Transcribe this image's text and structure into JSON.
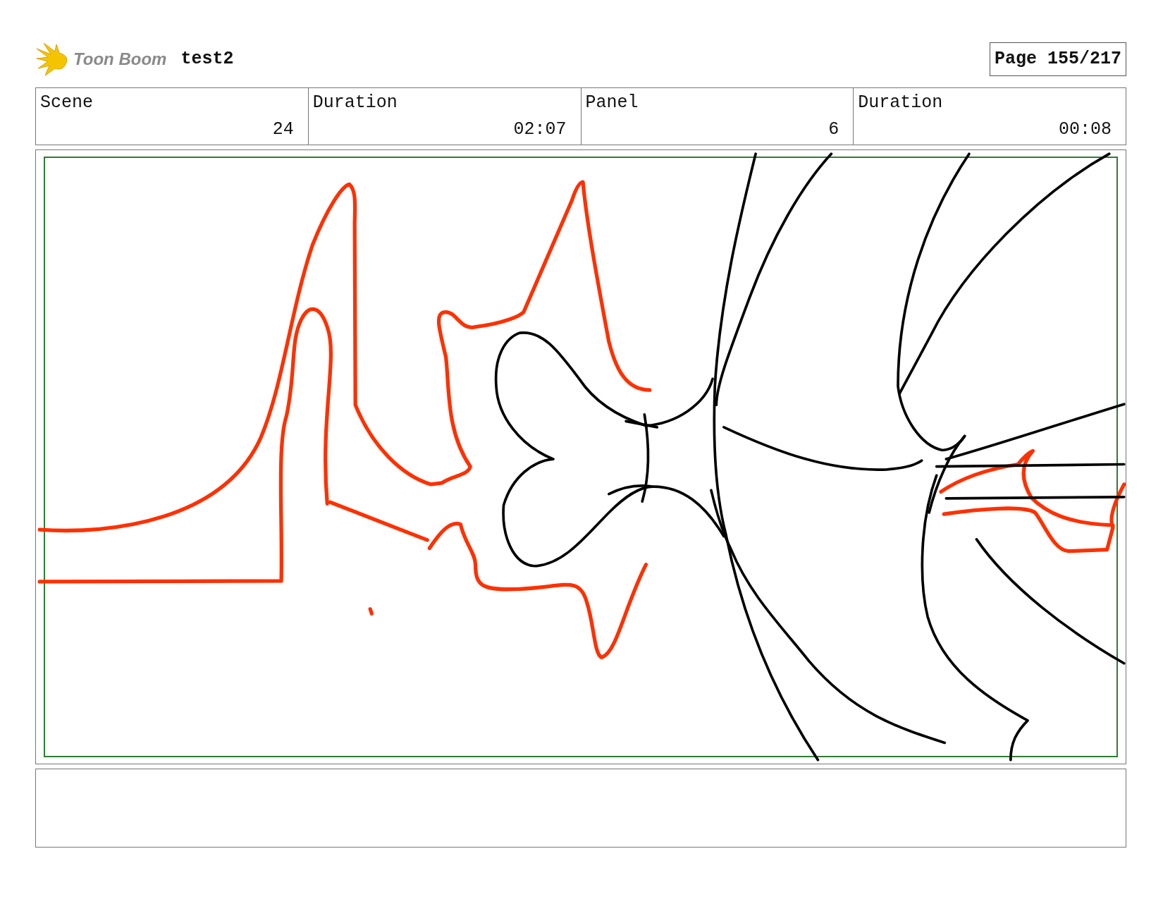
{
  "header": {
    "logo_text": "Toon Boom",
    "project_title": "test2",
    "page_label": "Page 155/217"
  },
  "info_fields": [
    {
      "label": "Scene",
      "value": "24"
    },
    {
      "label": "Duration",
      "value": "02:07"
    },
    {
      "label": "Panel",
      "value": "6"
    },
    {
      "label": "Duration",
      "value": "00:08"
    }
  ]
}
